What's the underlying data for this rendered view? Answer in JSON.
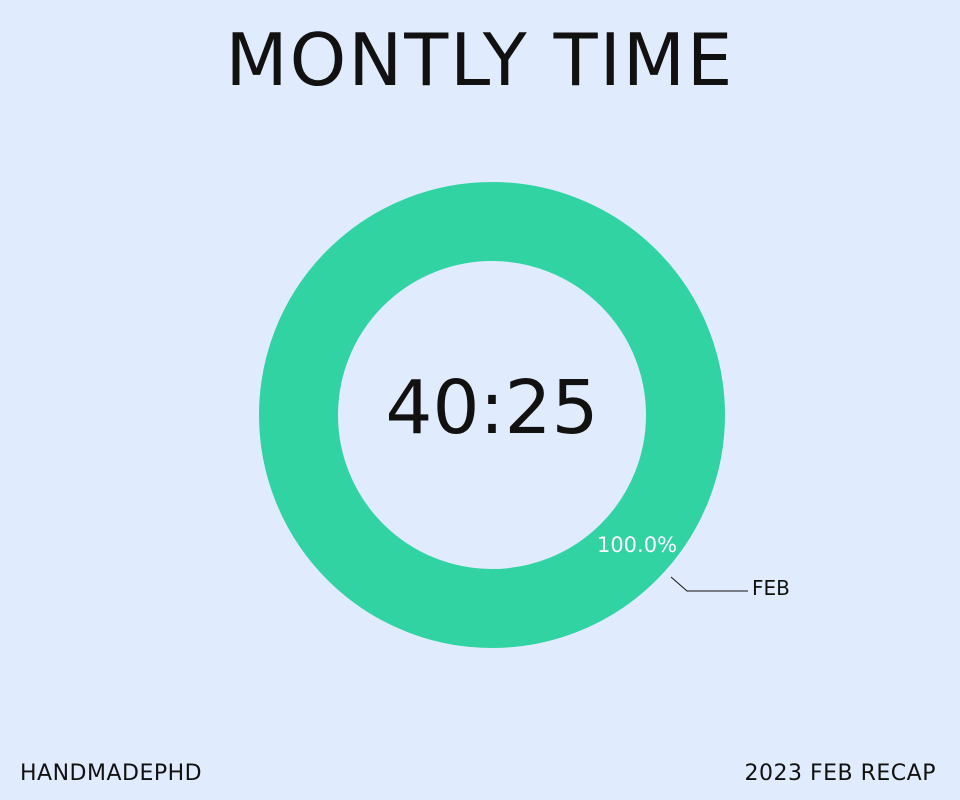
{
  "title": "MONTLY TIME",
  "footer": {
    "left": "HANDMADEPHD",
    "right": "2023 FEB RECAP"
  },
  "chart_data": {
    "type": "pie",
    "variant": "donut",
    "center_label": "40:25",
    "slices": [
      {
        "label": "FEB",
        "value": 100.0,
        "percent_label": "100.0%",
        "color": "#32d3a3"
      }
    ],
    "colors": {
      "background": "#e0ecfe",
      "ring": "#32d3a3",
      "text": "#111111",
      "percent_text": "#ffffff"
    }
  }
}
